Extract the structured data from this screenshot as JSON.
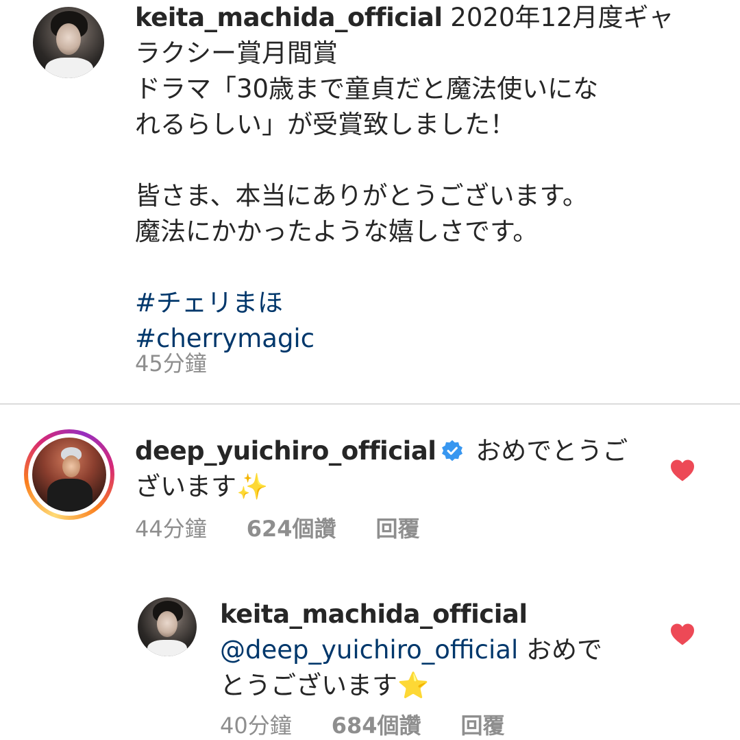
{
  "post": {
    "username": "keita_machida_official",
    "caption_lines": [
      " 2020年12月度ギャ",
      "ラクシー賞月間賞",
      "ドラマ「30歳まで童貞だと魔法使いにな",
      "れるらしい」が受賞致しました！",
      "",
      "皆さま、本当にありがとうございます。",
      "魔法にかかったような嬉しさです。",
      ""
    ],
    "hashtags": [
      "#チェリまほ",
      "#cherrymagic"
    ],
    "time": "45分鐘"
  },
  "comment": {
    "username": "deep_yuichiro_official",
    "text_line1": " おめでとうご",
    "text_line2": "ざいます✨",
    "time": "44分鐘",
    "likes": "624個讚",
    "reply_label": "回覆",
    "liked": true,
    "verified": true
  },
  "reply": {
    "username": "keita_machida_official",
    "mention": "@deep_yuichiro_official",
    "text_after_mention": " おめで",
    "text_line3": "とうございます⭐",
    "time": "40分鐘",
    "likes": "684個讚",
    "reply_label": "回覆",
    "liked": true
  },
  "colors": {
    "heart": "#ed4956",
    "link": "#00376b",
    "meta": "#8e8e8e",
    "verified": "#3897f0"
  }
}
